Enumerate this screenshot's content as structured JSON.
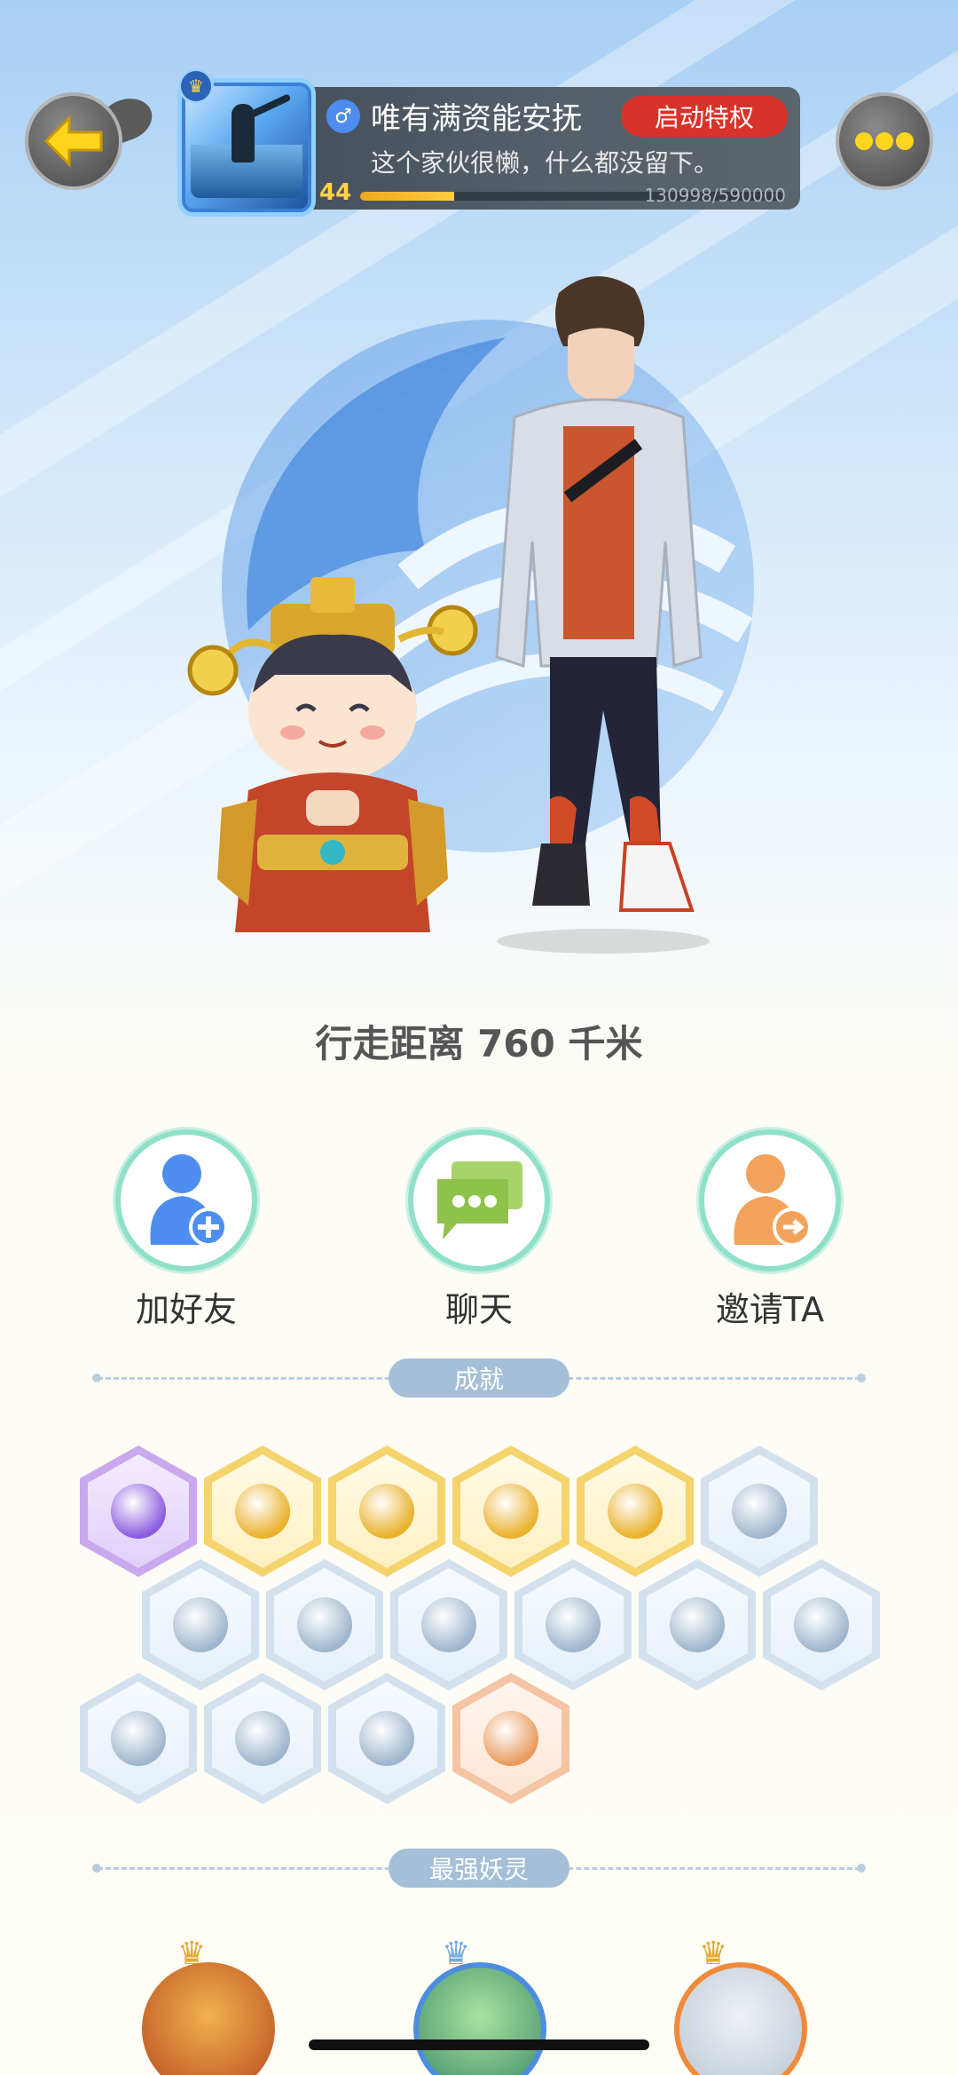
{
  "header": {
    "player_name": "唯有满资能安抚",
    "gender_symbol": "♂",
    "privilege_button": "启动特权",
    "signature": "这个家伙很懒，什么都没留下。",
    "level": "44",
    "exp_text": "130998/590000",
    "exp_progress": 0.222
  },
  "icons": {
    "back": "arrow-left-icon",
    "more": "more-dots-icon",
    "crown": "crown-icon"
  },
  "distance_text": "行走距离 760 千米",
  "actions": [
    {
      "label": "加好友",
      "icon": "add-friend-icon"
    },
    {
      "label": "聊天",
      "icon": "chat-icon"
    },
    {
      "label": "邀请TA",
      "icon": "invite-icon"
    }
  ],
  "sections": {
    "achievements_title": "成就",
    "spirits_title": "最强妖灵"
  },
  "achievements": [
    {
      "tier": "purple",
      "icon": "demon-face-icon"
    },
    {
      "tier": "gold",
      "icon": "sun-staff-icon"
    },
    {
      "tier": "gold",
      "icon": "golden-orb-icon"
    },
    {
      "tier": "gold",
      "icon": "yin-yang-comet-icon"
    },
    {
      "tier": "gold",
      "icon": "yin-yang-scroll-icon"
    },
    {
      "tier": "silver",
      "icon": "sneaker-icon"
    },
    {
      "tier": "silver",
      "icon": "moon-icon"
    },
    {
      "tier": "silver",
      "icon": "crystal-icon"
    },
    {
      "tier": "silver",
      "icon": "spirit-figure-icon"
    },
    {
      "tier": "silver",
      "icon": "cat-spirit-icon"
    },
    {
      "tier": "silver",
      "icon": "fish-spirit-icon"
    },
    {
      "tier": "silver",
      "icon": "shield-banner-icon"
    },
    {
      "tier": "silver",
      "icon": "bull-statue-icon"
    },
    {
      "tier": "silver",
      "icon": "bunny-pair-icon"
    },
    {
      "tier": "silver",
      "icon": "fox-book-icon"
    },
    {
      "tier": "orange",
      "icon": "cat-stroller-icon"
    }
  ],
  "colors": {
    "privilege": "#d8332a",
    "exp_fill": "#f0a91e",
    "action_ring": "#8fe0c8",
    "add_friend": "#4e8ef0",
    "chat": "#8fc24a",
    "invite": "#f2a25a"
  }
}
